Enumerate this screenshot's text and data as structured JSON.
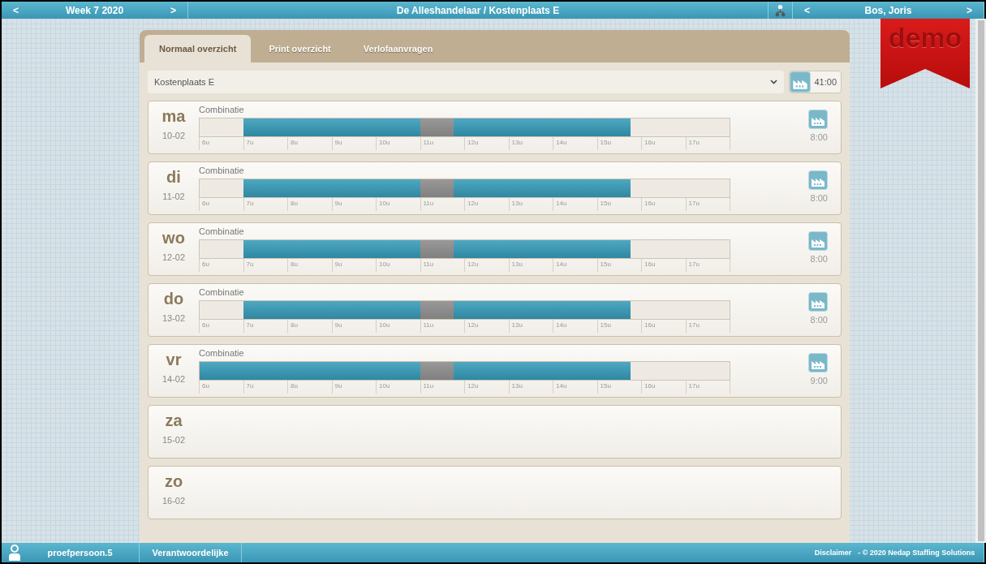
{
  "top_bar": {
    "prev_week": "<",
    "week": "Week 7 2020",
    "next_week": ">",
    "title": "De Alleshandelaar / Kostenplaats E",
    "prev_person": "<",
    "person": "Bos, Joris",
    "next_person": ">"
  },
  "ribbon": {
    "text": "demo"
  },
  "tabs": [
    {
      "label": "Normaal overzicht",
      "selected": true
    },
    {
      "label": "Print overzicht",
      "selected": false
    },
    {
      "label": "Verlofaanvragen",
      "selected": false
    }
  ],
  "filter": {
    "value": "Kostenplaats E",
    "total": "41:00"
  },
  "days": [
    {
      "day": "ma",
      "date": "10-02",
      "label": "Combinatie",
      "total": "8:00",
      "timeline": [
        {
          "kind": "off"
        },
        {
          "kind": "work"
        },
        {
          "kind": "work"
        },
        {
          "kind": "work"
        },
        {
          "kind": "work"
        },
        {
          "kind": "break"
        },
        {
          "kind": "work"
        },
        {
          "kind": "work"
        },
        {
          "kind": "work"
        },
        {
          "kind": "work"
        }
      ],
      "hours": [
        "6u",
        "7u",
        "8u",
        "9u",
        "10u",
        "11u",
        "12u",
        "13u",
        "14u",
        "15u",
        "16u",
        "17u"
      ]
    },
    {
      "day": "di",
      "date": "11-02",
      "label": "Combinatie",
      "total": "8:00",
      "timeline": [
        {
          "kind": "off"
        },
        {
          "kind": "work"
        },
        {
          "kind": "work"
        },
        {
          "kind": "work"
        },
        {
          "kind": "work"
        },
        {
          "kind": "break"
        },
        {
          "kind": "work"
        },
        {
          "kind": "work"
        },
        {
          "kind": "work"
        },
        {
          "kind": "work"
        }
      ],
      "hours": [
        "6u",
        "7u",
        "8u",
        "9u",
        "10u",
        "11u",
        "12u",
        "13u",
        "14u",
        "15u",
        "16u",
        "17u"
      ]
    },
    {
      "day": "wo",
      "date": "12-02",
      "label": "Combinatie",
      "total": "8:00",
      "timeline": [
        {
          "kind": "off"
        },
        {
          "kind": "work"
        },
        {
          "kind": "work"
        },
        {
          "kind": "work"
        },
        {
          "kind": "work"
        },
        {
          "kind": "break"
        },
        {
          "kind": "work"
        },
        {
          "kind": "work"
        },
        {
          "kind": "work"
        },
        {
          "kind": "work"
        }
      ],
      "hours": [
        "6u",
        "7u",
        "8u",
        "9u",
        "10u",
        "11u",
        "12u",
        "13u",
        "14u",
        "15u",
        "16u",
        "17u"
      ]
    },
    {
      "day": "do",
      "date": "13-02",
      "label": "Combinatie",
      "total": "8:00",
      "timeline": [
        {
          "kind": "off"
        },
        {
          "kind": "work"
        },
        {
          "kind": "work"
        },
        {
          "kind": "work"
        },
        {
          "kind": "work"
        },
        {
          "kind": "break"
        },
        {
          "kind": "work"
        },
        {
          "kind": "work"
        },
        {
          "kind": "work"
        },
        {
          "kind": "work"
        }
      ],
      "hours": [
        "6u",
        "7u",
        "8u",
        "9u",
        "10u",
        "11u",
        "12u",
        "13u",
        "14u",
        "15u",
        "16u",
        "17u"
      ]
    },
    {
      "day": "vr",
      "date": "14-02",
      "label": "Combinatie",
      "total": "9:00",
      "timeline": [
        {
          "kind": "work"
        },
        {
          "kind": "work"
        },
        {
          "kind": "work"
        },
        {
          "kind": "work"
        },
        {
          "kind": "work"
        },
        {
          "kind": "break"
        },
        {
          "kind": "work"
        },
        {
          "kind": "work"
        },
        {
          "kind": "work"
        },
        {
          "kind": "work"
        }
      ],
      "hours": [
        "6u",
        "7u",
        "8u",
        "9u",
        "10u",
        "11u",
        "12u",
        "13u",
        "14u",
        "15u",
        "16u",
        "17u"
      ]
    },
    {
      "day": "za",
      "date": "15-02"
    },
    {
      "day": "zo",
      "date": "16-02"
    }
  ],
  "bottom_bar": {
    "user": "proefpersoon.5",
    "role": "Verantwoordelijke",
    "disclaimer": "Disclaimer",
    "copyright": "- © 2020 Nedap Staffing Solutions"
  }
}
